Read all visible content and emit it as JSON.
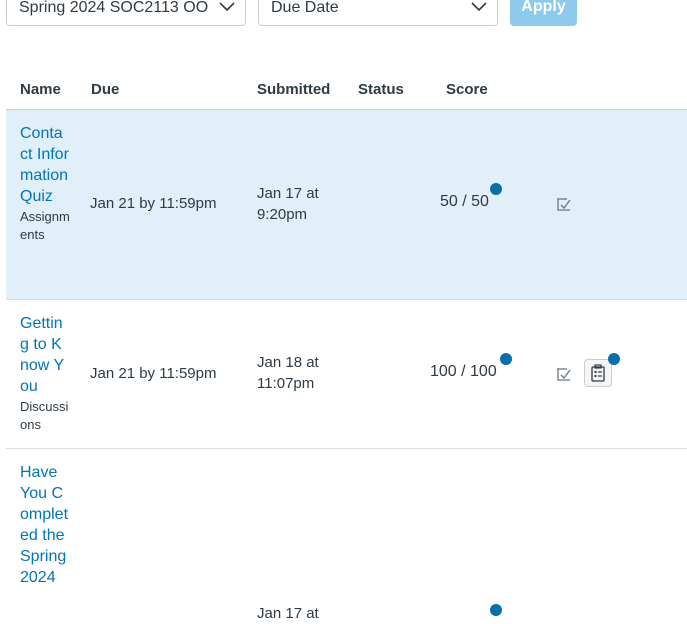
{
  "filters": {
    "course_value": "Spring 2024 SOC2113 OO",
    "sort_value": "Due Date",
    "apply_label": "Apply"
  },
  "table": {
    "columns": [
      "Name",
      "Due",
      "Submitted",
      "Status",
      "Score"
    ],
    "rows": [
      {
        "name": "Contact Information Quiz",
        "context": "Assignments",
        "due": "Jan 21 by 11:59pm",
        "submitted": "Jan 17 at 9:20pm",
        "status": "",
        "score": "50 / 50"
      },
      {
        "name": "Getting to Know You",
        "context": "Discussions",
        "due": "Jan 21 by 11:59pm",
        "submitted": "Jan 18 at 11:07pm",
        "status": "",
        "score": "100 / 100"
      },
      {
        "name": "Have You Completed the Spring 2024",
        "context": "",
        "due": "",
        "submitted": "Jan 17 at",
        "status": "",
        "score": ""
      }
    ]
  },
  "icons": {
    "chevron": "chevron-down-icon",
    "comment": "rubric-checkmark-icon",
    "rubric": "clipboard-icon",
    "unread": "unread-dot-icon"
  },
  "colors": {
    "link": "#0374b5",
    "row_highlight": "#e0eff8",
    "unread_dot": "#0770a8",
    "apply_button": "#8ec9ee"
  }
}
